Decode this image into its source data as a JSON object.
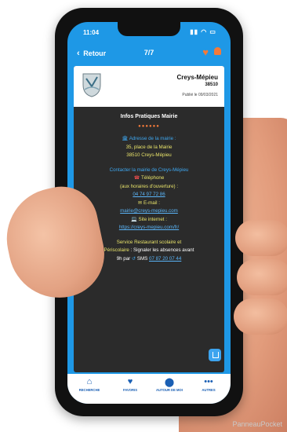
{
  "status": {
    "time": "11:04",
    "indicators": "▮▮ ◠ ▭"
  },
  "nav": {
    "back_label": "Retour",
    "pager": "7/7"
  },
  "header": {
    "town": "Creys-Mépieu",
    "zip": "38510",
    "published": "Publié le 09/03/2021"
  },
  "content": {
    "title": "Infos Pratiques Mairie",
    "dots": "●●●●●●",
    "addr_label": "Adresse de la mairie :",
    "addr_line1": "35, place de la Mairie",
    "addr_line2": "38510 Creys-Mépieu",
    "contact_title": "Contacter la mairie de Creys-Mépieu",
    "phone_label": "Téléphone",
    "phone_hours": "(aux horaires d'ouverture) :",
    "phone_number": "04 74 97 72 86",
    "email_label": "E-mail :",
    "email": "mairie@creys-mepieu.com",
    "site_label": "Site internet :",
    "site": "https://creys-mepieu.com/fr/",
    "service_line1": "Service Restaurant scolaire et",
    "service_line2a": "Périscolaire",
    "service_line2b": " : Signaler les absences avant",
    "service_line3a": "9h par ",
    "service_line3b": " SMS ",
    "sms_number": "07 87 20 07 44"
  },
  "tabs": [
    {
      "label": "RECHERCHE",
      "icon": "home-icon"
    },
    {
      "label": "FAVORIS",
      "icon": "heart-icon"
    },
    {
      "label": "AUTOUR DE MOI",
      "icon": "location-pin-icon"
    },
    {
      "label": "AUTRES",
      "icon": "more-icon"
    }
  ],
  "watermark": "PanneauPocket",
  "colors": {
    "app_blue": "#1e98e6",
    "accent_orange": "#f37a3a",
    "card_dark": "#2b2b2b",
    "text_yellow": "#e8e36a"
  }
}
